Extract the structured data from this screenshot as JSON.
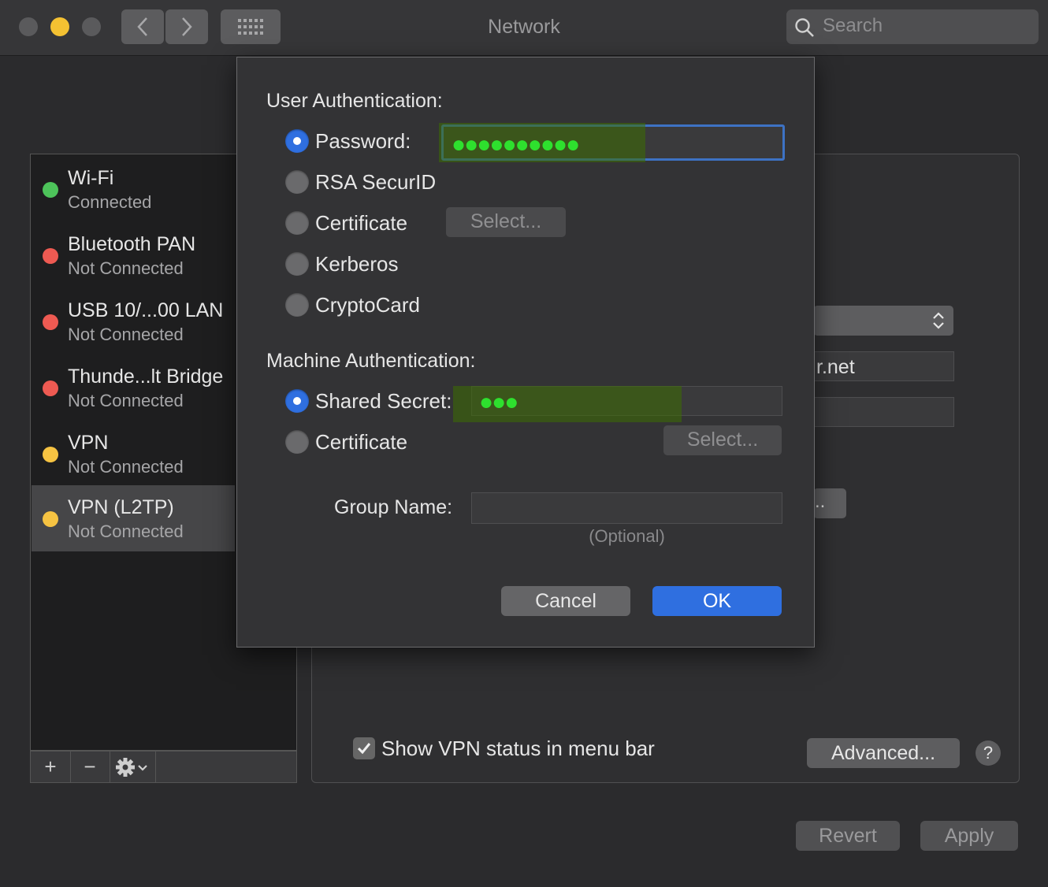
{
  "window": {
    "title": "Network",
    "search_placeholder": "Search",
    "traffic_lights": {
      "close": "#f05d57",
      "minimize": "#f4c132",
      "zoom": "#5a5a5c"
    }
  },
  "sidebar": {
    "services": [
      {
        "name": "Wi-Fi",
        "status": "Connected",
        "color": "#4dc35a"
      },
      {
        "name": "Bluetooth PAN",
        "status": "Not Connected",
        "color": "#ee5a52"
      },
      {
        "name": "USB 10/...00 LAN",
        "status": "Not Connected",
        "color": "#ee5a52"
      },
      {
        "name": "Thunde...lt Bridge",
        "status": "Not Connected",
        "color": "#ee5a52"
      },
      {
        "name": "VPN",
        "status": "Not Connected",
        "color": "#f6c342"
      },
      {
        "name": "VPN (L2TP)",
        "status": "Not Connected",
        "color": "#f6c342",
        "selected": true
      }
    ],
    "toolbar": {
      "add": "+",
      "remove": "−"
    }
  },
  "detail": {
    "peek_server_text": "r.net",
    "peek_button_text": "..",
    "show_vpn_status_label": "Show VPN status in menu bar",
    "show_vpn_status_checked": true,
    "advanced_label": "Advanced...",
    "help_label": "?",
    "revert_label": "Revert",
    "apply_label": "Apply"
  },
  "sheet": {
    "user_auth_label": "User Authentication:",
    "user_auth_options": [
      {
        "label": "Password:",
        "selected": true
      },
      {
        "label": "RSA SecurID",
        "selected": false
      },
      {
        "label": "Certificate",
        "selected": false
      },
      {
        "label": "Kerberos",
        "selected": false
      },
      {
        "label": "CryptoCard",
        "selected": false
      }
    ],
    "password_value": "●●●●●●●●●●",
    "certificate_select_label": "Select...",
    "machine_auth_label": "Machine Authentication:",
    "machine_auth_options": [
      {
        "label": "Shared Secret:",
        "selected": true
      },
      {
        "label": "Certificate",
        "selected": false
      }
    ],
    "shared_secret_value": "●●●",
    "machine_certificate_select_label": "Select...",
    "group_name_label": "Group Name:",
    "group_name_value": "",
    "group_name_hint": "(Optional)",
    "cancel_label": "Cancel",
    "ok_label": "OK",
    "accent_color": "#2f6fe0"
  }
}
